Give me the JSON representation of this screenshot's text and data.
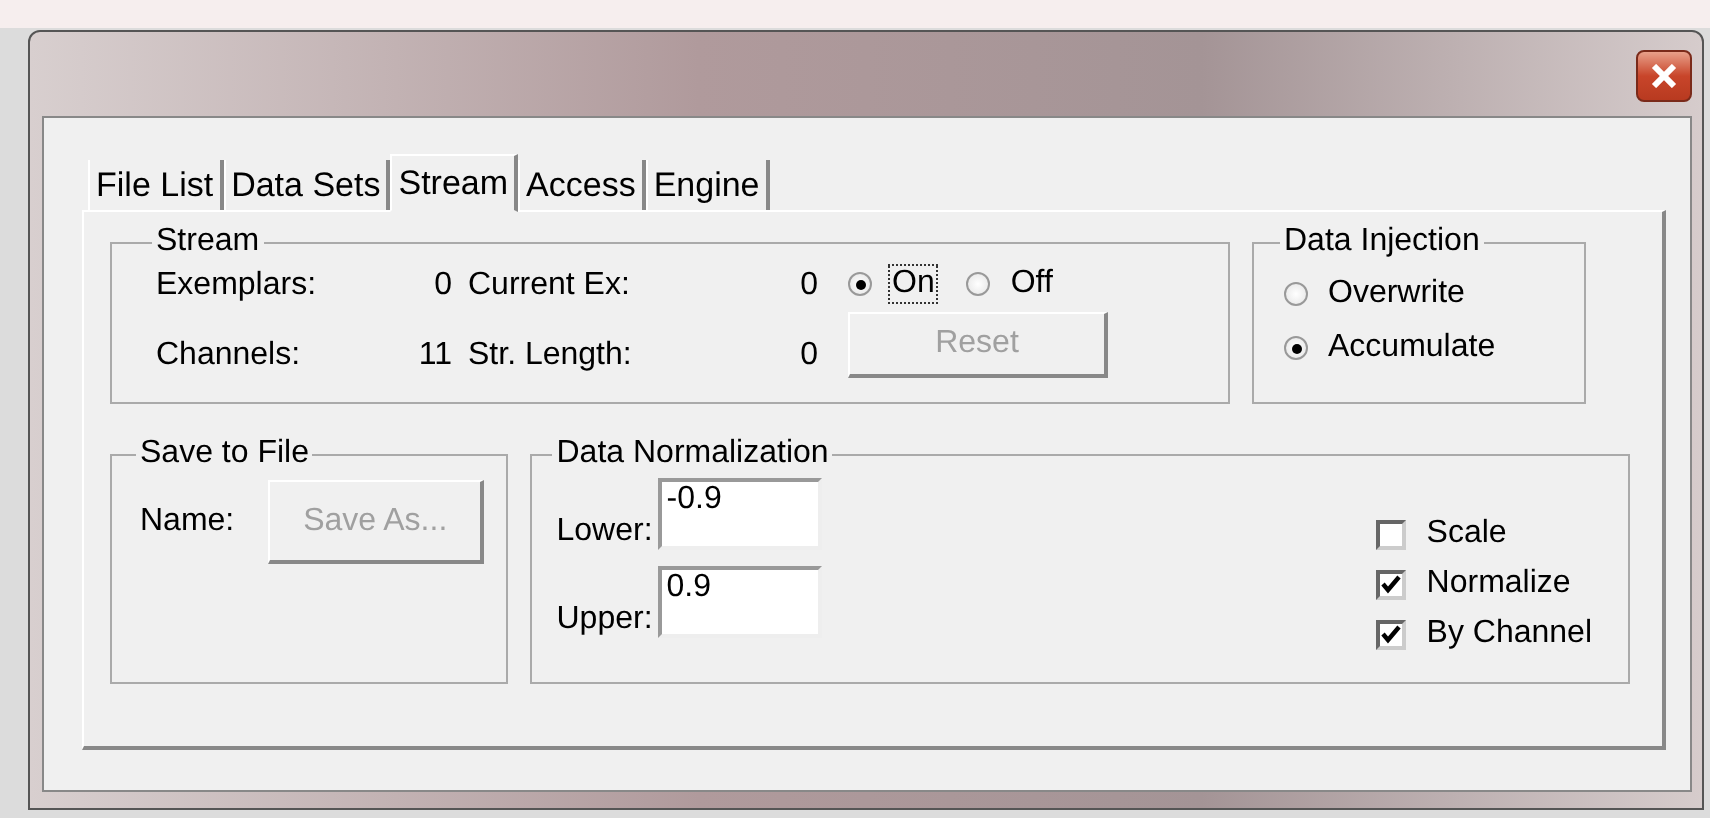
{
  "tabs": [
    {
      "label": "File List",
      "selected": false
    },
    {
      "label": "Data Sets",
      "selected": false
    },
    {
      "label": "Stream",
      "selected": true
    },
    {
      "label": "Access",
      "selected": false
    },
    {
      "label": "Engine",
      "selected": false
    }
  ],
  "stream": {
    "title": "Stream",
    "stats": [
      {
        "label": "Exemplars:",
        "value": "0",
        "label2": "Current Ex:",
        "value2": "0"
      },
      {
        "label": "Channels:",
        "value": "11",
        "label2": "Str. Length:",
        "value2": "0"
      }
    ],
    "modes": [
      {
        "label": "On",
        "selected": true,
        "focused": true
      },
      {
        "label": "Off",
        "selected": false,
        "focused": false
      }
    ],
    "reset_button": {
      "label": "Reset",
      "disabled": true
    }
  },
  "data_injection": {
    "title": "Data Injection",
    "options": [
      {
        "label": "Overwrite",
        "selected": false
      },
      {
        "label": "Accumulate",
        "selected": true
      }
    ]
  },
  "save_to_file": {
    "title": "Save to File",
    "name_label": "Name:",
    "button": {
      "label": "Save As...",
      "disabled": true
    }
  },
  "normalization": {
    "title": "Data Normalization",
    "fields": [
      {
        "label": "Lower:",
        "value": "-0.9"
      },
      {
        "label": "Upper:",
        "value": "0.9"
      }
    ],
    "options": [
      {
        "label": "Scale",
        "checked": false
      },
      {
        "label": "Normalize",
        "checked": true
      },
      {
        "label": "By Channel",
        "checked": true
      }
    ]
  }
}
